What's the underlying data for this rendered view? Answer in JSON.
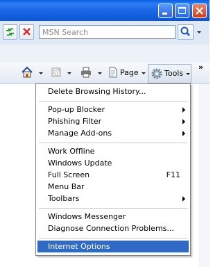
{
  "search": {
    "placeholder": "MSN Search"
  },
  "toolbar": {
    "page_label": "Page",
    "tools_label": "Tools",
    "overflow": "»"
  },
  "icons": {
    "refresh": "refresh-icon",
    "stop": "stop-icon",
    "search": "magnifier-icon",
    "home": "home-icon",
    "feeds": "rss-feed-icon",
    "print": "printer-icon",
    "page": "page-icon",
    "tools": "gear-icon"
  },
  "colors": {
    "title_bar": "#0a55d6",
    "selection": "#316ac5"
  },
  "tools_menu": {
    "items": [
      {
        "label": "Delete Browsing History..."
      },
      {
        "label": "Pop-up Blocker"
      },
      {
        "label": "Phishing Filter"
      },
      {
        "label": "Manage Add-ons"
      },
      {
        "label": "Work Offline"
      },
      {
        "label": "Windows Update"
      },
      {
        "label": "Full Screen",
        "shortcut": "F11"
      },
      {
        "label": "Menu Bar"
      },
      {
        "label": "Toolbars"
      },
      {
        "label": "Windows Messenger"
      },
      {
        "label": "Diagnose Connection Problems..."
      },
      {
        "label": "Internet Options"
      }
    ],
    "selected": "Internet Options"
  }
}
